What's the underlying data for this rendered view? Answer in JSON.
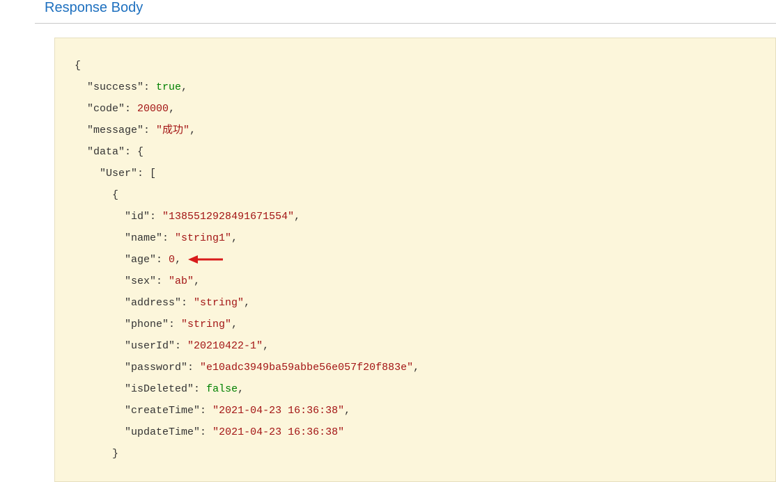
{
  "header": {
    "title": "Response Body"
  },
  "json": {
    "success": {
      "key": "\"success\"",
      "value": "true"
    },
    "code": {
      "key": "\"code\"",
      "value": "20000"
    },
    "message": {
      "key": "\"message\"",
      "value": "\"成功\""
    },
    "data": {
      "key": "\"data\""
    },
    "user": {
      "key": "\"User\""
    },
    "fields": {
      "id": {
        "key": "\"id\"",
        "value": "\"1385512928491671554\""
      },
      "name": {
        "key": "\"name\"",
        "value": "\"string1\""
      },
      "age": {
        "key": "\"age\"",
        "value": "0"
      },
      "sex": {
        "key": "\"sex\"",
        "value": "\"ab\""
      },
      "address": {
        "key": "\"address\"",
        "value": "\"string\""
      },
      "phone": {
        "key": "\"phone\"",
        "value": "\"string\""
      },
      "userId": {
        "key": "\"userId\"",
        "value": "\"20210422-1\""
      },
      "password": {
        "key": "\"password\"",
        "value": "\"e10adc3949ba59abbe56e057f20f883e\""
      },
      "isDeleted": {
        "key": "\"isDeleted\"",
        "value": "false"
      },
      "createTime": {
        "key": "\"createTime\"",
        "value": "\"2021-04-23 16:36:38\""
      },
      "updateTime": {
        "key": "\"updateTime\"",
        "value": "\"2021-04-23 16:36:38\""
      }
    }
  }
}
